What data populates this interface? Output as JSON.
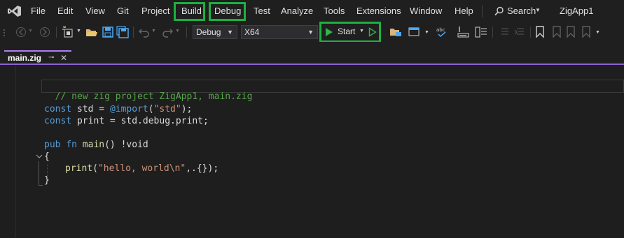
{
  "menu": {
    "items": [
      "File",
      "Edit",
      "View",
      "Git",
      "Project",
      "Build",
      "Debug",
      "Test",
      "Analyze",
      "Tools",
      "Extensions",
      "Window",
      "Help"
    ],
    "search_label": "Search",
    "project_name": "ZigApp1"
  },
  "toolbar": {
    "config_value": "Debug",
    "platform_value": "X64",
    "start_label": "Start"
  },
  "tab": {
    "filename": "main.zig",
    "pin_glyph": "⊸",
    "close_glyph": "✕"
  },
  "code": {
    "comment": "// new zig project ZigApp1, main.zig",
    "line_const": "const",
    "line_std_rest": " std = ",
    "line_import": "@import",
    "line_paren_open": "(",
    "line_std_str": "\"std\"",
    "line_paren_close": ");",
    "line2_rest": " print = std.debug.print;",
    "pub": "pub",
    "fn": "fn",
    "main": "main",
    "main_rest": "() !void",
    "brace_open": "{",
    "print_fn": "print",
    "print_open": "(",
    "print_str": "\"hello, world\\n\"",
    "print_rest": ",.{});",
    "brace_close": "}"
  },
  "colors": {
    "highlight_box": "#1db040",
    "tab_accent": "#8a63d2",
    "keyword": "#569cd6",
    "string": "#ce9178",
    "comment": "#57a64a",
    "start_green": "#2fb34a"
  }
}
